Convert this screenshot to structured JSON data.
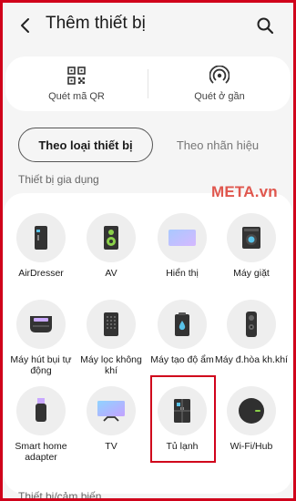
{
  "header": {
    "title": "Thêm thiết bị",
    "back_icon": "arrow-left-icon",
    "search_icon": "search-icon"
  },
  "scan": {
    "qr_label": "Quét mã QR",
    "nearby_label": "Quét ở gần"
  },
  "tabs": [
    {
      "label": "Theo loại thiết bị",
      "active": true
    },
    {
      "label": "Theo nhãn hiệu",
      "active": false
    }
  ],
  "sections": {
    "home_appliances": "Thiết bị gia dụng",
    "sensors": "Thiết bị/cảm biến"
  },
  "watermark": "META.vn",
  "devices": [
    {
      "label": "AirDresser",
      "icon": "airdresser-icon"
    },
    {
      "label": "AV",
      "icon": "speaker-icon"
    },
    {
      "label": "Hiển thị",
      "icon": "display-icon"
    },
    {
      "label": "Máy giặt",
      "icon": "washer-icon"
    },
    {
      "label": "Máy hút bụi tự động",
      "icon": "robot-vacuum-icon"
    },
    {
      "label": "Máy lọc không khí",
      "icon": "air-purifier-icon"
    },
    {
      "label": "Máy tạo độ ẩm",
      "icon": "humidifier-icon"
    },
    {
      "label": "Máy đ.hòa kh.khí",
      "icon": "air-conditioner-icon"
    },
    {
      "label": "Smart home adapter",
      "icon": "usb-adapter-icon"
    },
    {
      "label": "TV",
      "icon": "tv-icon"
    },
    {
      "label": "Tủ lạnh",
      "icon": "refrigerator-icon"
    },
    {
      "label": "Wi-Fi/Hub",
      "icon": "wifi-hub-icon"
    }
  ],
  "colors": {
    "accent_red": "#d0021b",
    "background": "#f5f5f5",
    "card": "#ffffff"
  }
}
